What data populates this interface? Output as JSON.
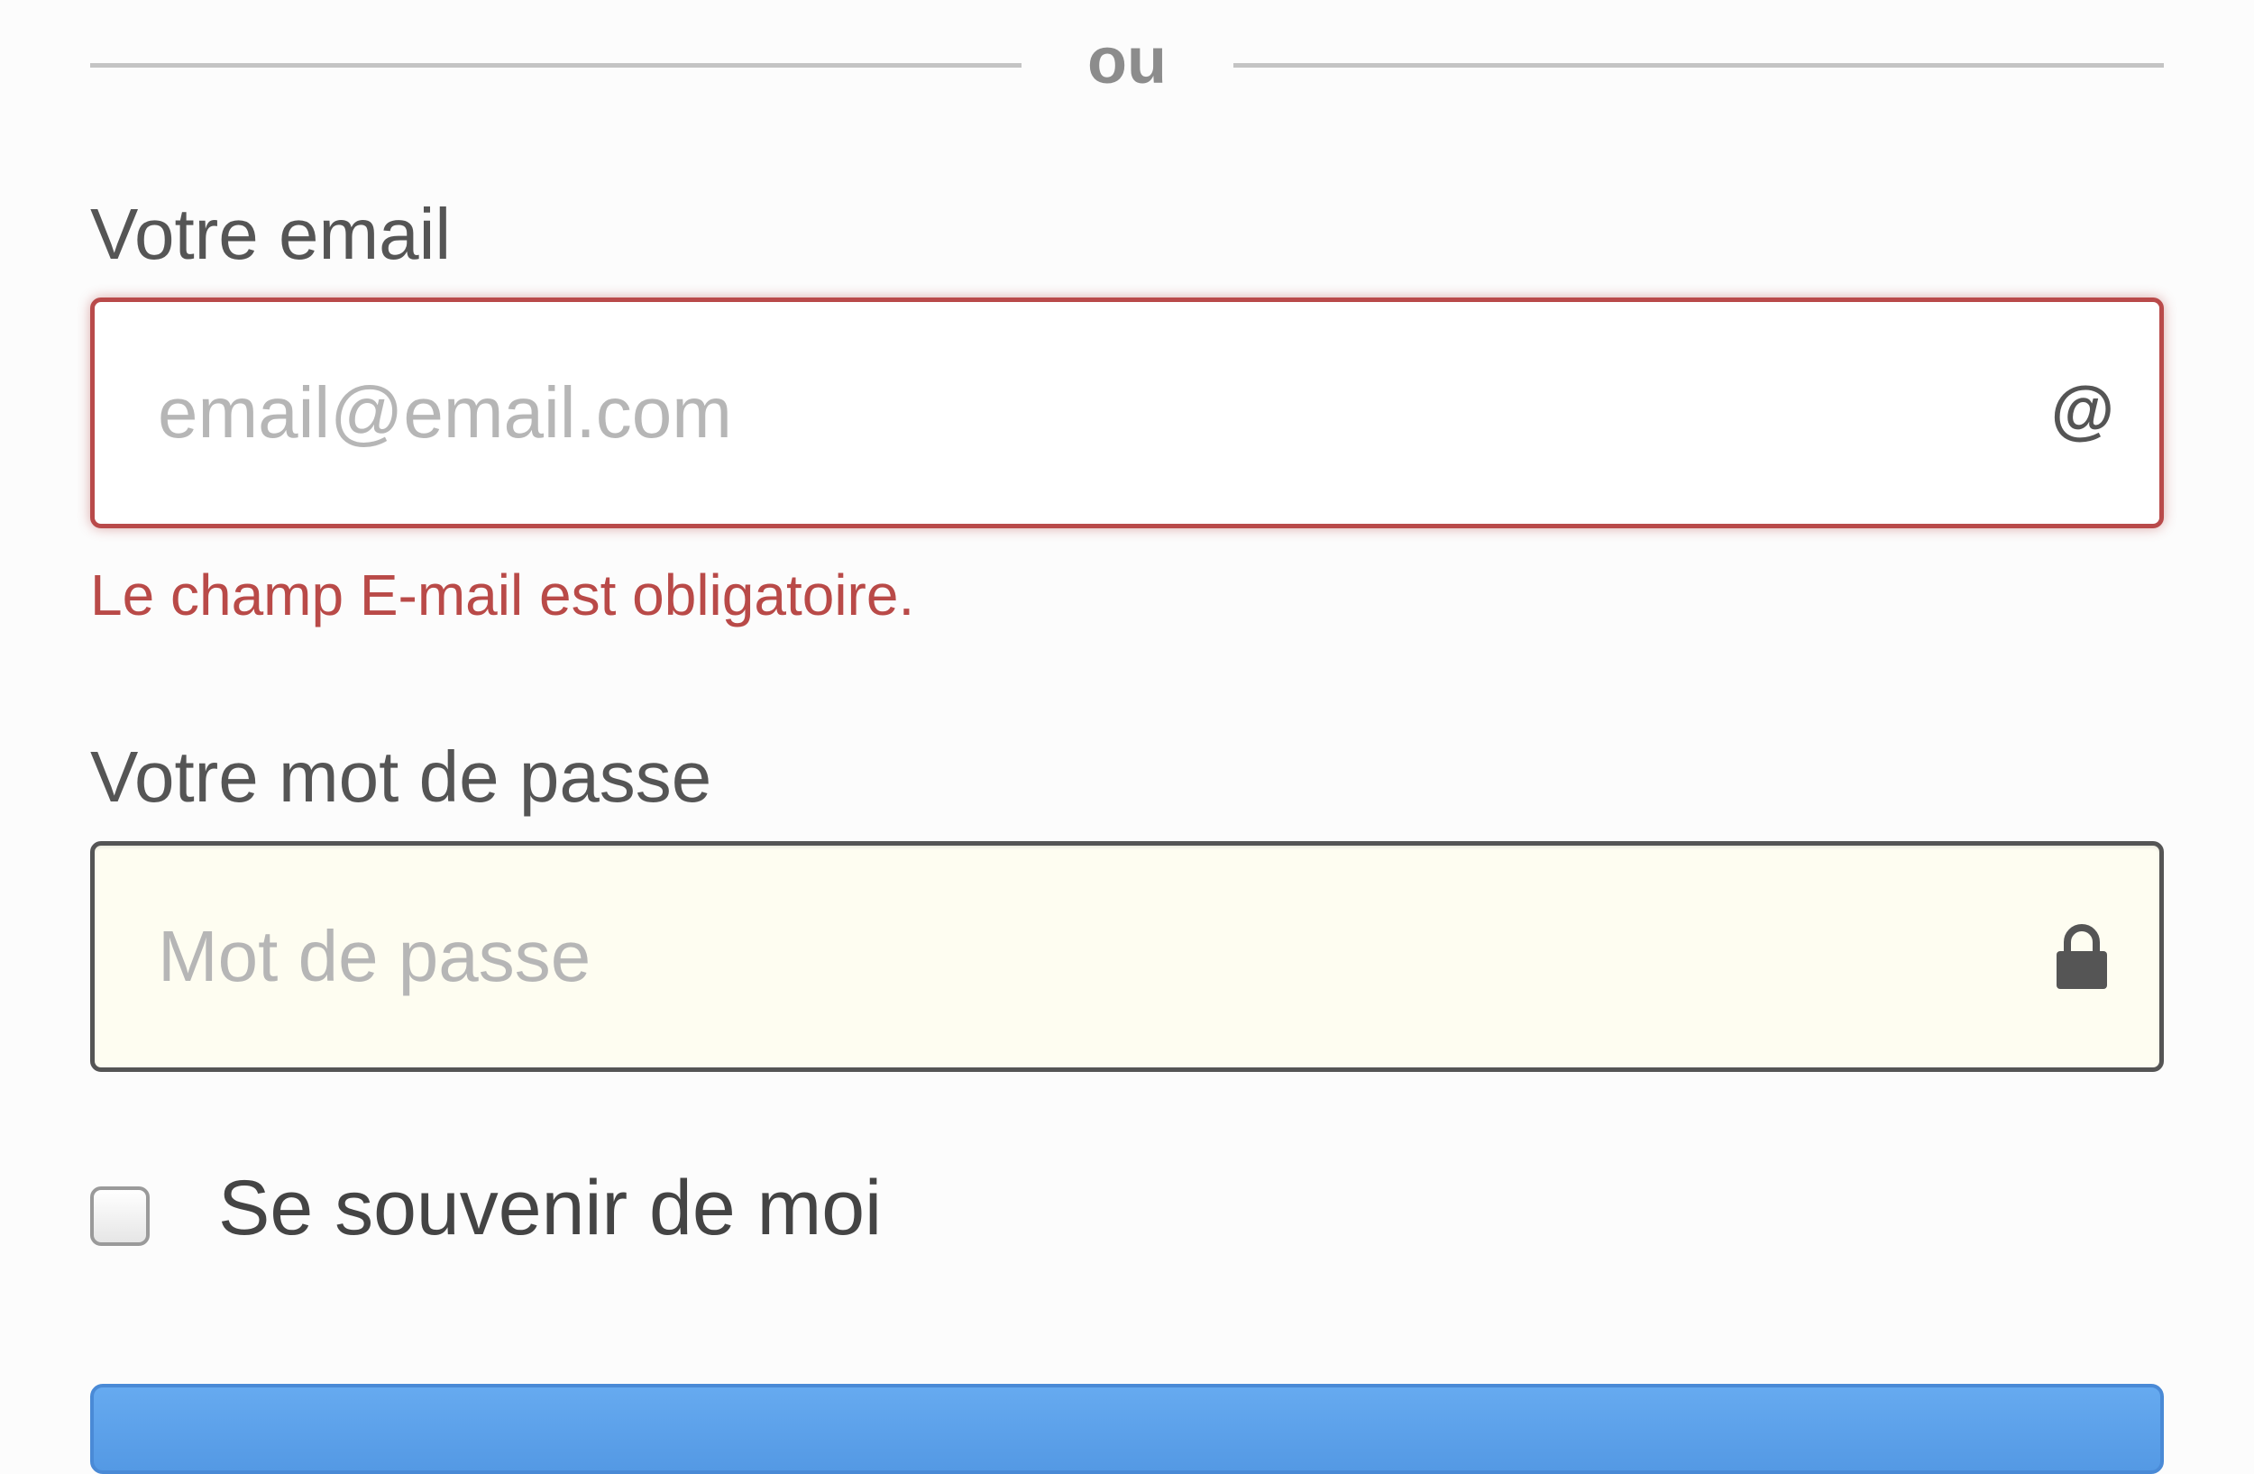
{
  "divider": {
    "text": "ou"
  },
  "email": {
    "label": "Votre email",
    "placeholder": "email@email.com",
    "value": "",
    "icon": "at-icon",
    "icon_glyph": "@",
    "error": "Le champ E-mail est obligatoire.",
    "error_color": "#b94a48"
  },
  "password": {
    "label": "Votre mot de passe",
    "placeholder": "Mot de passe",
    "value": "",
    "icon": "lock-icon",
    "background": "#fefdf1"
  },
  "remember": {
    "label": "Se souvenir de moi",
    "checked": false
  },
  "submit": {
    "label": "",
    "color": "#5ea2ec"
  }
}
